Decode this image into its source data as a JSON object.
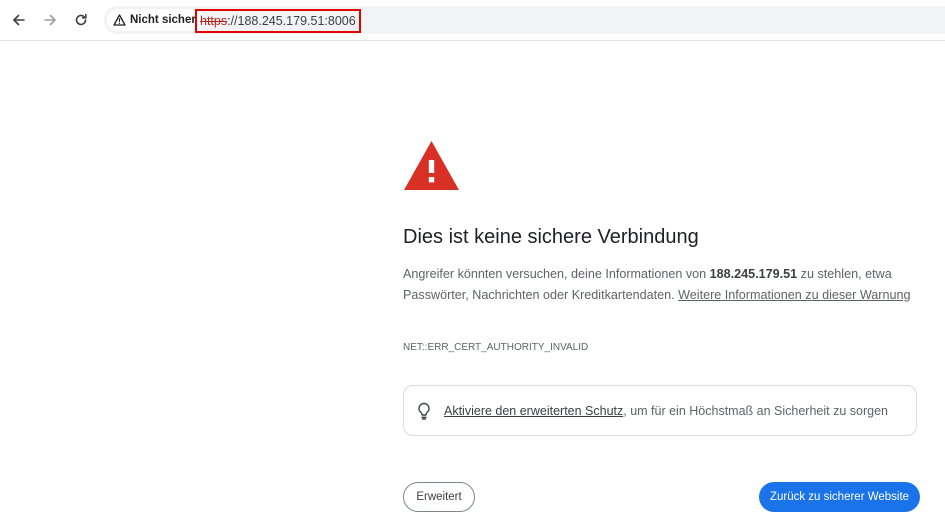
{
  "browser": {
    "back_icon": "arrow-left-icon",
    "forward_icon": "arrow-right-icon",
    "reload_icon": "reload-icon",
    "security_chip": {
      "icon": "warning-triangle-icon",
      "label": "Nicht sicher"
    },
    "url": {
      "scheme": "https",
      "rest": "://188.245.179.51:8006"
    }
  },
  "interstitial": {
    "icon": "warning-triangle-icon",
    "icon_color": "#d93025",
    "title": "Dies ist keine sichere Verbindung",
    "body_pre": "Angreifer könnten versuchen, deine Informationen von ",
    "body_host": "188.245.179.51",
    "body_post": " zu stehlen, etwa Passwörter, Nachrichten oder Kreditkartendaten. ",
    "learn_more_link": "Weitere Informationen zu dieser Warnung",
    "error_code": "NET::ERR_CERT_AUTHORITY_INVALID",
    "enhanced_protection": {
      "icon": "lightbulb-icon",
      "link": "Aktiviere den erweiterten Schutz",
      "text": ", um für ein Höchstmaß an Sicherheit zu sorgen"
    },
    "advanced_button": "Erweitert",
    "back_button": "Zurück zu sicherer Website",
    "primary_color": "#1a73e8"
  }
}
